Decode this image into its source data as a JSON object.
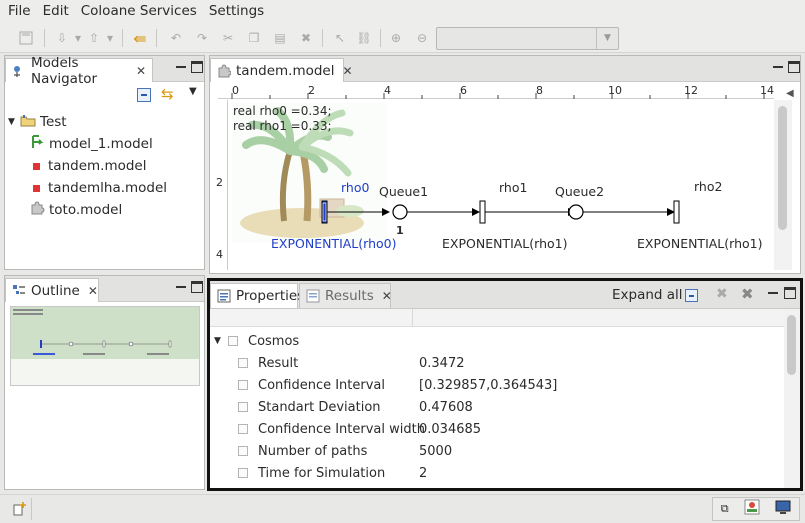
{
  "menu": [
    "File",
    "Edit",
    "Coloane Services",
    "Settings"
  ],
  "navigator": {
    "title": "Models Navigator",
    "root": "Test",
    "items": [
      "model_1.model",
      "tandem.model",
      "tandemlha.model",
      "toto.model"
    ]
  },
  "outline": {
    "title": "Outline"
  },
  "editor": {
    "tab": "tandem.model",
    "ruler_labels": [
      "0",
      "2",
      "4",
      "6",
      "8",
      "10",
      "12",
      "14"
    ],
    "vruler_labels": [
      "2",
      "4"
    ],
    "decl_line1": "real rho0 =0.34;",
    "decl_line2": "real rho1 =0.33;",
    "t0_name": "rho0",
    "t0_dist": "EXPONENTIAL(rho0)",
    "p1_name": "Queue1",
    "p1_tokens": "1",
    "t1_name": "rho1",
    "t1_dist": "EXPONENTIAL(rho1)",
    "p2_name": "Queue2",
    "t2_name": "rho2",
    "t2_dist": "EXPONENTIAL(rho1)"
  },
  "properties": {
    "tab_properties": "Properties",
    "tab_results": "Results",
    "expand_all": "Expand all",
    "group": "Cosmos",
    "rows": [
      {
        "name": "Result",
        "value": "0.3472"
      },
      {
        "name": "Confidence Interval",
        "value": "[0.329857,0.364543]"
      },
      {
        "name": "Standart Deviation",
        "value": "0.47608"
      },
      {
        "name": "Confidence Interval width",
        "value": "0.034685"
      },
      {
        "name": "Number of paths",
        "value": "5000"
      },
      {
        "name": "Time for Simulation",
        "value": "2"
      }
    ]
  },
  "colors": {
    "transition_blue": "#1f3ec9",
    "selection_border": "#000000",
    "red_marker": "#e23434"
  },
  "icons": [
    "folder-icon",
    "model-icon",
    "puzzle-icon",
    "collapse-all-icon",
    "link-icon",
    "outline-icon",
    "properties-icon",
    "results-icon"
  ]
}
